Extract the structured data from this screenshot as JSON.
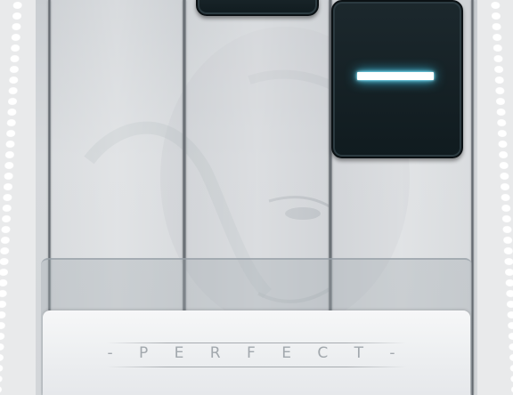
{
  "judgement": {
    "text": "- P E R F E C T -"
  },
  "colors": {
    "tile": "#131e22",
    "tile_glow": "#5fe3ff",
    "lane_divider": "#6b7076",
    "border_dots": "#ffffff",
    "background": "#d3d6d9"
  },
  "playfield": {
    "lanes": 3,
    "tiles": [
      {
        "lane": 2,
        "state": "upcoming",
        "highlighted": false
      },
      {
        "lane": 3,
        "state": "active",
        "highlighted": true
      }
    ]
  }
}
